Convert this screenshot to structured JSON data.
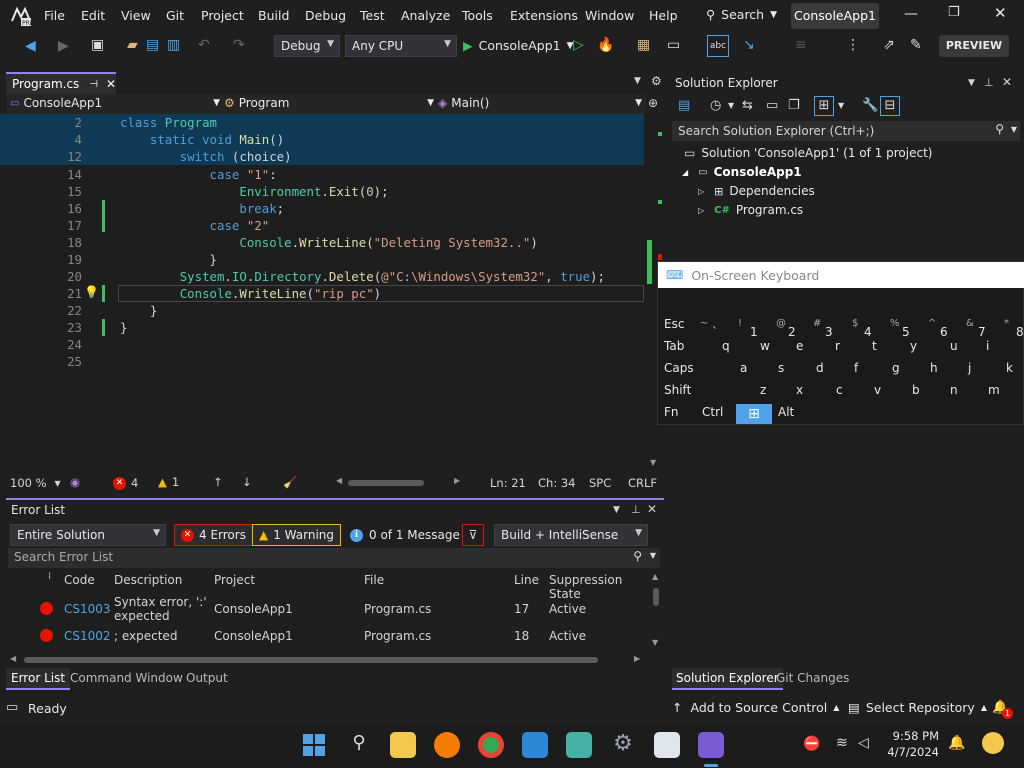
{
  "menu": {
    "items": [
      "File",
      "Edit",
      "View",
      "Git",
      "Project",
      "Build",
      "Debug",
      "Test",
      "Analyze",
      "Tools",
      "Extensions",
      "Window",
      "Help"
    ],
    "search_label": "Search",
    "solution_name": "ConsoleApp1"
  },
  "toolbar": {
    "config": "Debug",
    "platform": "Any CPU",
    "run_target": "ConsoleApp1",
    "preview_label": "PREVIEW"
  },
  "editor": {
    "tab_label": "Program.cs",
    "nav_project": "ConsoleApp1",
    "nav_class": "Program",
    "nav_member": "Main()",
    "lines": [
      {
        "n": "2",
        "html": "<span class='kw'>class</span> <span class='ty'>Program</span>"
      },
      {
        "n": "4",
        "html": "    <span class='kw'>static</span> <span class='kw'>void</span> <span class='mt'>Main</span>()"
      },
      {
        "n": "12",
        "html": "        <span class='kw'>switch</span> (choice)"
      },
      {
        "n": "14",
        "html": "            <span class='kw'>case</span> <span class='st'>\"1\"</span>:"
      },
      {
        "n": "15",
        "html": "                <span class='ty'>Environment</span>.<span class='mt'>Exit</span>(<span class='nm'>0</span>);"
      },
      {
        "n": "16",
        "html": "                <span class='kw'>break</span>;"
      },
      {
        "n": "17",
        "html": "            <span class='kw'>case</span> <span class='st'>\"2\"</span>"
      },
      {
        "n": "18",
        "html": "                <span class='ty'>Console</span>.<span class='mt'>WriteLine</span>(<span class='st'>\"Deleting System32..\"</span>)"
      },
      {
        "n": "19",
        "html": "            }"
      },
      {
        "n": "20",
        "html": "        <span class='ty'>System</span>.<span class='ty'>IO</span>.<span class='ty'>Directory</span>.<span class='mt'>Delete</span>(<span class='st'>@\"C:\\Windows\\System32\"</span>, <span class='kw'>true</span>);"
      },
      {
        "n": "21",
        "html": "        <span class='ty'>Console</span>.<span class='mt'>WriteLine</span>(<span class='st'>\"rip pc\"</span>)"
      },
      {
        "n": "22",
        "html": "    }"
      },
      {
        "n": "23",
        "html": "}"
      },
      {
        "n": "24",
        "html": ""
      },
      {
        "n": "25",
        "html": ""
      }
    ],
    "zoom": "100 %",
    "error_count": "4",
    "warning_count": "1",
    "ln": "Ln: 21",
    "ch": "Ch: 34",
    "spc": "SPC",
    "crlf": "CRLF"
  },
  "error_list": {
    "title": "Error List",
    "scope": "Entire Solution",
    "errors_btn": "4 Errors",
    "warning_btn": "1 Warning",
    "messages_btn": "0 of 1 Message",
    "source": "Build + IntelliSense",
    "search_placeholder": "Search Error List",
    "columns": [
      "Code",
      "Description",
      "Project",
      "File",
      "Line",
      "Suppression State"
    ],
    "rows": [
      {
        "code": "CS1003",
        "desc1": "Syntax error, ':'",
        "desc2": "expected",
        "project": "ConsoleApp1",
        "file": "Program.cs",
        "line": "17",
        "state": "Active"
      },
      {
        "code": "CS1002",
        "desc1": "; expected",
        "desc2": "",
        "project": "ConsoleApp1",
        "file": "Program.cs",
        "line": "18",
        "state": "Active"
      }
    ],
    "tabs": [
      "Error List",
      "Command Window",
      "Output"
    ]
  },
  "solution_explorer": {
    "title": "Solution Explorer",
    "search_placeholder": "Search Solution Explorer (Ctrl+;)",
    "solution_label": "Solution 'ConsoleApp1' (1 of 1 project)",
    "project": "ConsoleApp1",
    "dependencies": "Dependencies",
    "file": "Program.cs",
    "tabs": [
      "Solution Explorer",
      "Git Changes"
    ]
  },
  "keyboard": {
    "title": "On-Screen Keyboard",
    "row1": [
      [
        "Esc",
        ""
      ],
      [
        "~",
        "`"
      ],
      [
        "!",
        "1"
      ],
      [
        "@",
        "2"
      ],
      [
        "#",
        "3"
      ],
      [
        "$",
        "4"
      ],
      [
        "%",
        "5"
      ],
      [
        "^",
        "6"
      ],
      [
        "&",
        "7"
      ],
      [
        "*",
        "8"
      ]
    ],
    "row2": [
      "Tab",
      "q",
      "w",
      "e",
      "r",
      "t",
      "y",
      "u",
      "i"
    ],
    "row3": [
      "Caps",
      "a",
      "s",
      "d",
      "f",
      "g",
      "h",
      "j",
      "k"
    ],
    "row4": [
      "Shift",
      "z",
      "x",
      "c",
      "v",
      "b",
      "n",
      "m"
    ],
    "row5": [
      "Fn",
      "Ctrl",
      "",
      "Alt"
    ]
  },
  "status": {
    "ready": "Ready",
    "source_control": "Add to Source Control",
    "repository": "Select Repository",
    "notif_count": "1"
  },
  "taskbar": {
    "time": "9:58 PM",
    "date": "4/7/2024"
  }
}
